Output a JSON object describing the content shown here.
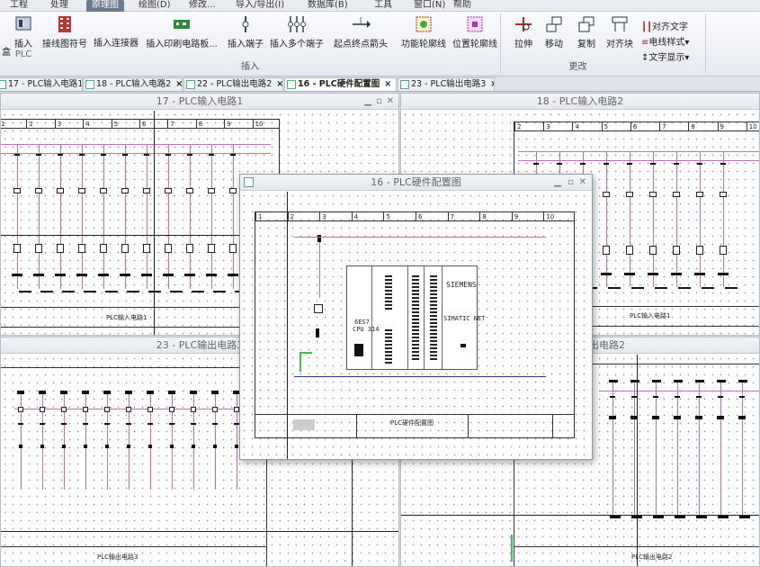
{
  "menus": [
    {
      "label": "工程",
      "active": false
    },
    {
      "label": "处理",
      "active": false
    },
    {
      "label": "原理图",
      "active": true
    },
    {
      "label": "绘图(D)",
      "active": false
    },
    {
      "label": "修改...",
      "active": false
    },
    {
      "label": "导入/导出(I)",
      "active": false
    },
    {
      "label": "数据库(B)",
      "active": false
    },
    {
      "label": "工具",
      "active": false
    },
    {
      "label": "窗口(N)",
      "active": false
    },
    {
      "label": "帮助",
      "active": false
    }
  ],
  "ribbon": {
    "insert_group": "插入",
    "modify_group": "更改",
    "insert_plc": "插入",
    "insert_plc_sub": "PLC",
    "wire_symbol": "接线图符号",
    "insert_connector": "插入连接器",
    "insert_pcb": "插入印刷电路板...",
    "insert_terminal": "插入端子",
    "insert_multi_terminal": "插入多个端子",
    "origin_arrow": "起点终点箭头",
    "func_outline": "功能轮廓线",
    "pos_outline": "位置轮廓线",
    "stretch": "拉伸",
    "move": "移动",
    "copy": "复制",
    "align_block": "对齐块",
    "align_text": "对齐文字",
    "wire_style": "电线样式",
    "text_display": "文字显示",
    "left_cut": "盒"
  },
  "tabs": [
    {
      "label": "17 - PLC输入电路1",
      "active": false
    },
    {
      "label": "18 - PLC输入电路2",
      "active": false
    },
    {
      "label": "22 - PLC输出电路2",
      "active": false
    },
    {
      "label": "16 - PLC硬件配置图",
      "active": true
    },
    {
      "label": "23 - PLC输出电路3",
      "active": false
    }
  ],
  "windows": {
    "w17": "17 - PLC输入电路1",
    "w18": "18 - PLC输入电路2",
    "w23": "23 - PLC输出电路3",
    "w22": "出电路2",
    "w16": "16 - PLC硬件配置图"
  },
  "sheet_titles": {
    "s17": "PLC输入电路1",
    "s18": "PLC输入电路1",
    "s16": "PLC硬件配置图",
    "s23": "PLC输出电路3",
    "s22": "PLC输出电路2"
  },
  "rulers": {
    "s16": [
      "1",
      "2",
      "3",
      "4",
      "5",
      "6",
      "7",
      "8",
      "9",
      "10"
    ],
    "s17": [
      "1",
      "2",
      "3",
      "4",
      "5",
      "6",
      "7",
      "8",
      "9",
      "10"
    ],
    "s18": [
      "2",
      "3",
      "4",
      "5",
      "6",
      "7",
      "8",
      "9",
      "10"
    ]
  },
  "plc": {
    "brand": "SIEMENS",
    "model": "SIMATIC NET",
    "cpu": "6ES7",
    "cpu2": "CPU 314"
  }
}
